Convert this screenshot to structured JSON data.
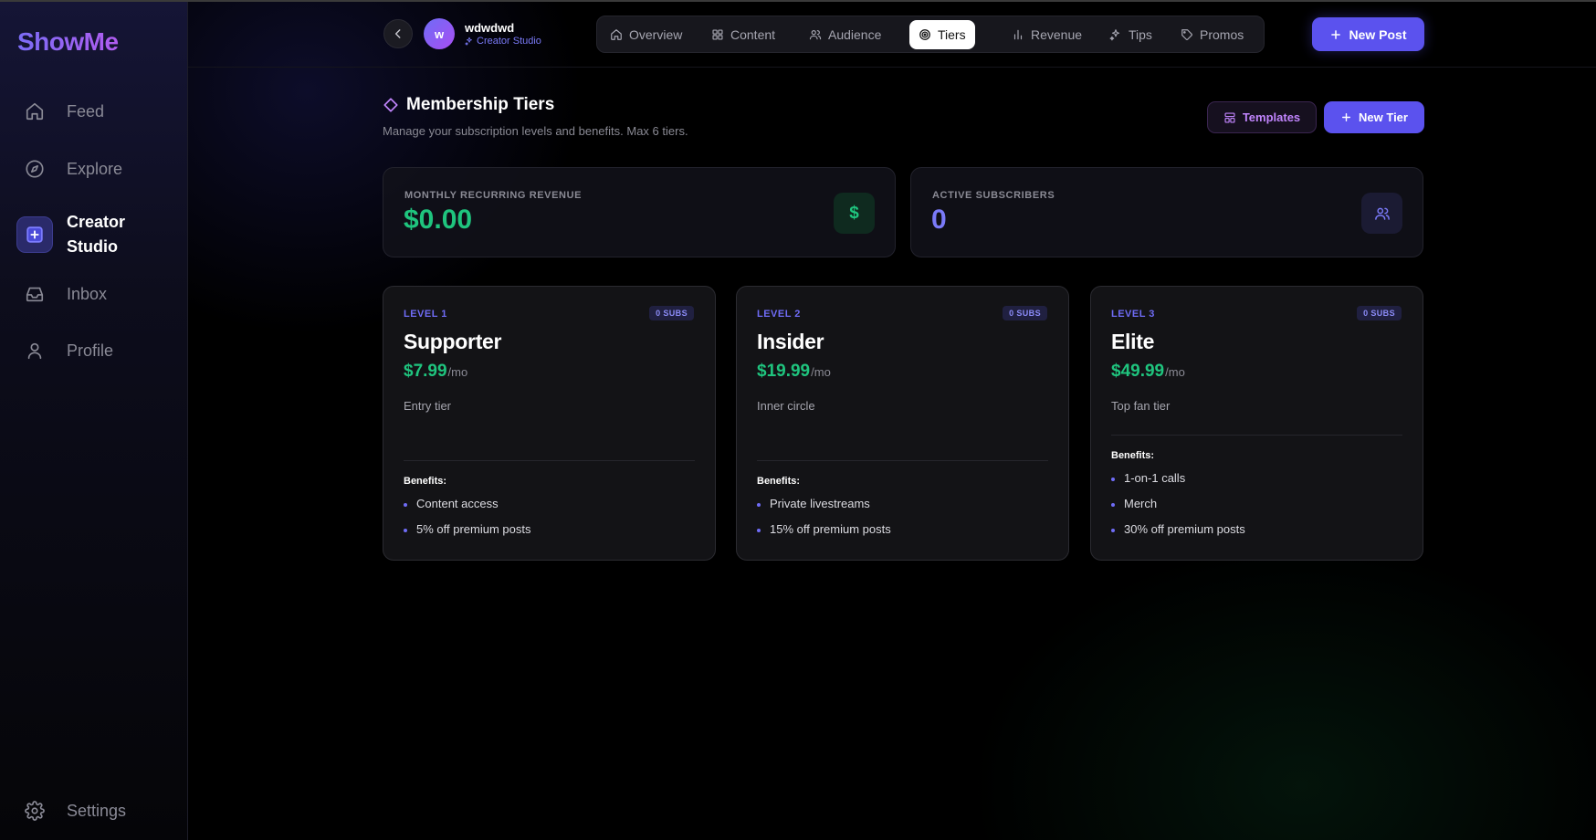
{
  "app": {
    "logo": "ShowMe"
  },
  "sidebar": {
    "items": [
      {
        "label": "Feed",
        "icon": "home-icon"
      },
      {
        "label": "Explore",
        "icon": "compass-icon"
      },
      {
        "label": "Creator Studio",
        "icon": "plus-square-icon",
        "active": true
      },
      {
        "label": "Inbox",
        "icon": "inbox-icon"
      },
      {
        "label": "Profile",
        "icon": "user-icon"
      }
    ],
    "settings_label": "Settings"
  },
  "header": {
    "user_initial": "w",
    "user_name": "wdwdwd",
    "user_role": "Creator Studio",
    "tabs": [
      {
        "label": "Overview",
        "icon": "home-icon"
      },
      {
        "label": "Content",
        "icon": "grid-icon"
      },
      {
        "label": "Audience",
        "icon": "users-icon"
      },
      {
        "label": "Tiers",
        "icon": "target-icon",
        "active": true
      },
      {
        "label": "Revenue",
        "icon": "bar-chart-icon"
      },
      {
        "label": "Tips",
        "icon": "sparkles-icon"
      },
      {
        "label": "Promos",
        "icon": "tag-icon"
      }
    ],
    "new_post_label": "New Post"
  },
  "page": {
    "title": "Membership Tiers",
    "subtitle": "Manage your subscription levels and benefits. Max 6 tiers.",
    "templates_label": "Templates",
    "new_tier_label": "New Tier"
  },
  "stats": {
    "mrr_label": "MONTHLY RECURRING REVENUE",
    "mrr_value": "$0.00",
    "mrr_icon_glyph": "$",
    "subs_label": "ACTIVE SUBSCRIBERS",
    "subs_value": "0"
  },
  "tiers": [
    {
      "level": "LEVEL 1",
      "badge": "0 SUBS",
      "name": "Supporter",
      "price": "$7.99",
      "period": "/mo",
      "description": "Entry tier",
      "benefits_title": "Benefits:",
      "benefits": [
        "Content access",
        "5% off premium posts"
      ]
    },
    {
      "level": "LEVEL 2",
      "badge": "0 SUBS",
      "name": "Insider",
      "price": "$19.99",
      "period": "/mo",
      "description": "Inner circle",
      "benefits_title": "Benefits:",
      "benefits": [
        "Private livestreams",
        "15% off premium posts"
      ]
    },
    {
      "level": "LEVEL 3",
      "badge": "0 SUBS",
      "name": "Elite",
      "price": "$49.99",
      "period": "/mo",
      "description": "Top fan tier",
      "benefits_title": "Benefits:",
      "benefits": [
        "1-on-1 calls",
        "Merch",
        "30% off premium posts"
      ]
    }
  ],
  "colors": {
    "accent": "#5b52ee",
    "price_green": "#1fc47e",
    "level_purple": "#6f6cf6",
    "template_purple": "#c084fc"
  }
}
